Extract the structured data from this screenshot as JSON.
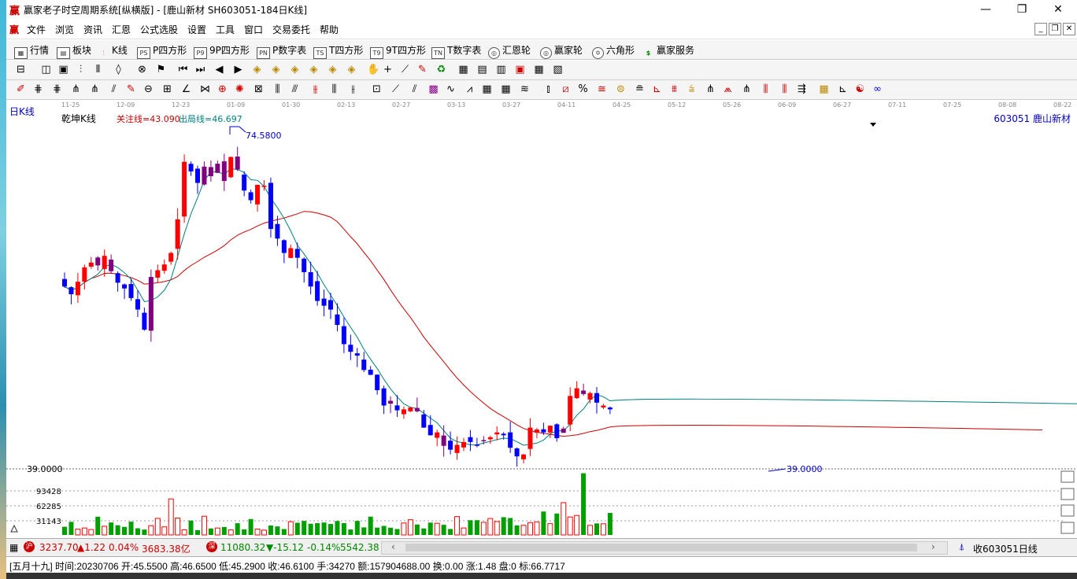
{
  "window": {
    "title": "赢家老子时空周期系统[纵横版] - [鹿山新材  SH603051-184日K线]",
    "minimize": "—",
    "restore": "❐",
    "close": "✕"
  },
  "menu": [
    "文件",
    "浏览",
    "资讯",
    "汇恩",
    "公式选股",
    "设置",
    "工具",
    "窗口",
    "交易委托",
    "帮助"
  ],
  "nav": [
    {
      "label": "行情",
      "icon": "grid"
    },
    {
      "label": "板块",
      "icon": "blocks"
    },
    {
      "label": "K线",
      "icon": "candles"
    },
    {
      "label": "P四方形",
      "icon": "PS"
    },
    {
      "label": "9P四方形",
      "icon": "P9"
    },
    {
      "label": "P数字表",
      "icon": "PN"
    },
    {
      "label": "T四方形",
      "icon": "TS"
    },
    {
      "label": "9T四方形",
      "icon": "T9"
    },
    {
      "label": "T数字表",
      "icon": "TN"
    },
    {
      "label": "汇恩轮",
      "icon": "wheel"
    },
    {
      "label": "赢家轮",
      "icon": "wheel"
    },
    {
      "label": "六角形",
      "icon": "hexagon"
    },
    {
      "label": "赢家服务",
      "icon": "dollar"
    }
  ],
  "time_axis": [
    "11-25",
    "12-09",
    "12-23",
    "01-09",
    "01-30",
    "02-13",
    "02-27",
    "03-13",
    "03-27",
    "04-11",
    "04-25",
    "05-12",
    "05-26",
    "06-09",
    "06-27",
    "07-11",
    "07-25",
    "08-08",
    "08-22"
  ],
  "chart": {
    "period_label": "日K线",
    "indicator_name": "乾坤K线",
    "focus_line": "关注线=43.090",
    "exit_line": "出局线=46.697",
    "stock": "603051  鹿山新材",
    "high_mark": "74.5800",
    "low_mark": "39.0000",
    "price_axis_label": "39.0000",
    "volume_ticks": [
      "93428",
      "62285",
      "31143"
    ],
    "colors": {
      "up": "#ff0000",
      "down": "#0000ff",
      "transition": "#800080",
      "volume_up": "#ff0000",
      "volume_down": "#00a000",
      "slow_line": "#cc0000",
      "fast_line": "#008080"
    }
  },
  "chart_data": {
    "type": "candlestick",
    "ylim": [
      39.0,
      74.58
    ],
    "high": 74.58,
    "low": 39.0,
    "closes": [
      58.0,
      57.2,
      58.5,
      60.0,
      60.5,
      60.2,
      61.2,
      59.6,
      58.4,
      57.8,
      56.8,
      55.6,
      53.5,
      59.0,
      59.7,
      60.3,
      61.5,
      65.0,
      71.0,
      70.0,
      68.8,
      70.5,
      69.5,
      70.8,
      69.0,
      71.5,
      70.2,
      68.0,
      67.0,
      68.6,
      68.5,
      64.0,
      63.0,
      61.5,
      62.0,
      61.0,
      59.5,
      58.0,
      56.5,
      56.0,
      55.6,
      54.0,
      52.0,
      51.2,
      50.8,
      49.3,
      48.8,
      47.2,
      45.6,
      45.8,
      45.1,
      45.2,
      45.4,
      45.0,
      43.3,
      42.5,
      42.8,
      41.4,
      41.0,
      41.5,
      41.8,
      41.8,
      41.4,
      42.0,
      42.3,
      42.8,
      42.5,
      41.2,
      40.3,
      40.5,
      43.3,
      43.1,
      42.8,
      43.5,
      42.2,
      43.2,
      46.6,
      47.4,
      46.8,
      46.9,
      45.9,
      45.6,
      45.2
    ]
  },
  "status": {
    "sh_label": "沪",
    "sh_index": "3237.70",
    "sh_change": "▲1.22",
    "sh_pct": "0.04%",
    "sh_amount": "3683.38亿",
    "sz_label": "深",
    "sz_index": "11080.32",
    "sz_change": "▼-15.12",
    "sz_pct": "-0.14%",
    "sz_amount": "5542.38",
    "right_label": "收603051日线"
  },
  "info": {
    "text": "[五月十九] 时间:20230706 开:45.5500 高:46.6500 低:45.2900 收:46.6100 手:34270 额:157904688.00 换:0.00 涨:1.48 盘:0 标:66.7717"
  }
}
